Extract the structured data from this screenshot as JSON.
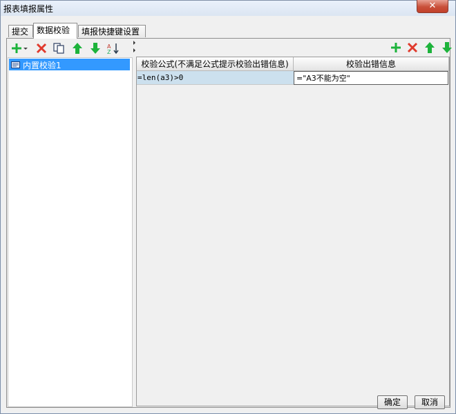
{
  "window": {
    "title": "报表填报属性",
    "close_label": "✕"
  },
  "tabs": [
    {
      "label": "提交"
    },
    {
      "label": "数据校验"
    },
    {
      "label": "填报快捷键设置"
    }
  ],
  "active_tab": 1,
  "left_toolbar": {
    "icons": [
      "add-dropdown-icon",
      "delete-icon",
      "copy-icon",
      "move-up-icon",
      "move-down-icon",
      "sort-icon"
    ]
  },
  "validation_list": {
    "items": [
      {
        "label": "内置校验1",
        "selected": true
      }
    ]
  },
  "right_toolbar": {
    "icons": [
      "add-icon",
      "delete-icon",
      "move-up-icon",
      "move-down-icon"
    ]
  },
  "table": {
    "columns": [
      "校验公式(不满足公式提示校验出错信息)",
      "校验出错信息"
    ],
    "rows": [
      [
        "=len(a3)>0",
        "=\"A3不能为空\""
      ]
    ]
  },
  "footer": {
    "ok_label": "确定",
    "cancel_label": "取消"
  },
  "colors": {
    "accent_green": "#1db33b",
    "delete_red": "#e03a2d",
    "selection_blue": "#3399ff"
  }
}
